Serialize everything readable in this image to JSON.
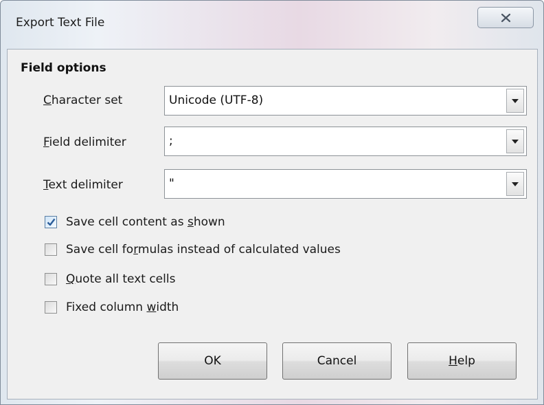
{
  "window": {
    "title": "Export Text File",
    "close_icon": "close-x-icon"
  },
  "section": {
    "title": "Field options"
  },
  "fields": [
    {
      "label_mnemonic": "C",
      "label_rest": "haracter set",
      "value": "Unicode (UTF-8)"
    },
    {
      "label_mnemonic": "F",
      "label_rest": "ield delimiter",
      "value": ";"
    },
    {
      "label_mnemonic": "T",
      "label_rest": "ext delimiter",
      "value": "\""
    }
  ],
  "options": [
    {
      "label_before": "Save cell content as ",
      "label_mnemonic": "s",
      "label_after": "hown",
      "checked": true
    },
    {
      "label_before": "Save cell fo",
      "label_mnemonic": "r",
      "label_after": "mulas instead of calculated values",
      "checked": false
    },
    {
      "label_before": "",
      "label_mnemonic": "Q",
      "label_after": "uote all text cells",
      "checked": false
    },
    {
      "label_before": "Fixed column ",
      "label_mnemonic": "w",
      "label_after": "idth",
      "checked": false
    }
  ],
  "buttons": {
    "ok_label": "OK",
    "cancel_label": "Cancel",
    "help_mnemonic": "H",
    "help_rest": "elp"
  },
  "colors": {
    "check_mark": "#2b5d9a",
    "client_bg": "#f0f0f0"
  }
}
